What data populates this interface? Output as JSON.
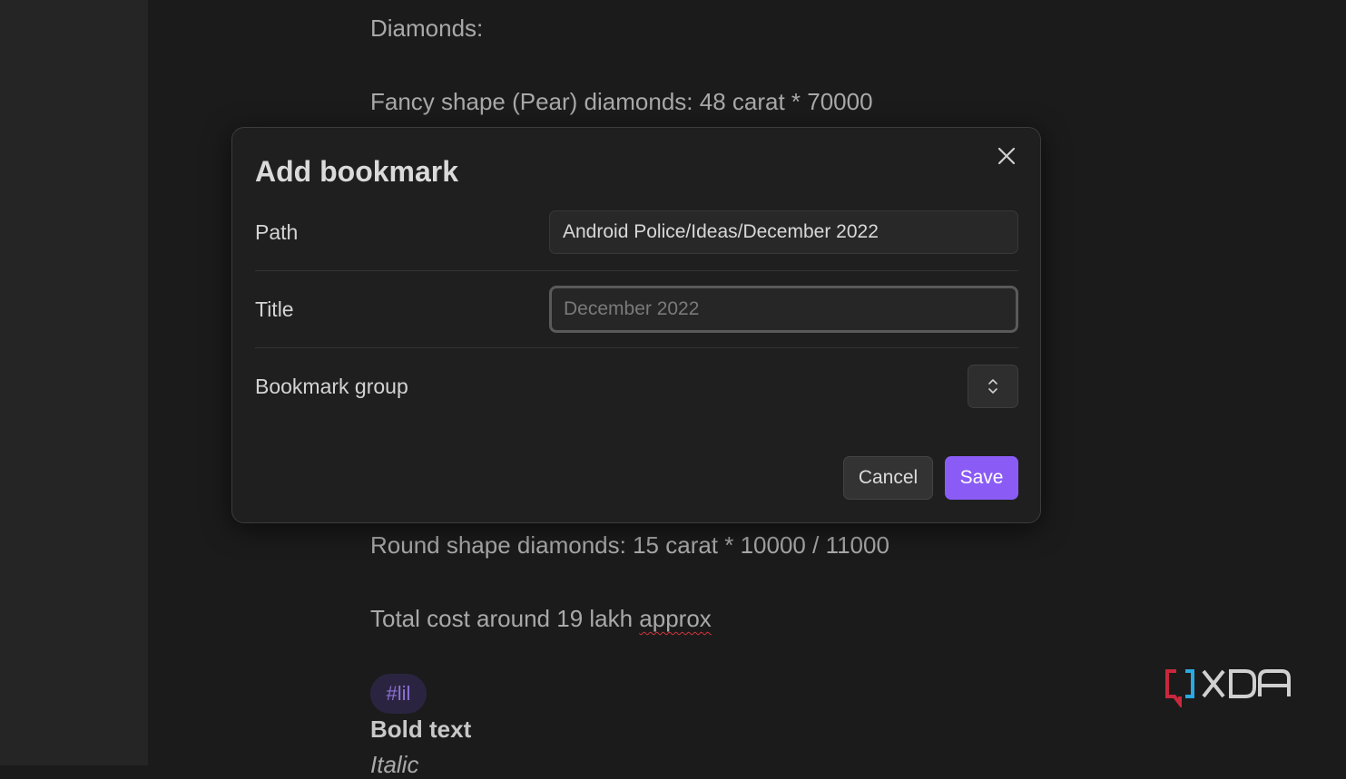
{
  "editor": {
    "line1": "Diamonds:",
    "line2": "Fancy shape (Pear) diamonds: 48 carat * 70000",
    "line3": "Round shape diamonds: 15 carat * 10000 / 11000",
    "line4_prefix": "Total cost around 19 lakh ",
    "line4_misspelled": "approx",
    "tag": "#lil",
    "bold_line": "Bold text",
    "italic_line": "Italic"
  },
  "modal": {
    "title": "Add bookmark",
    "path_label": "Path",
    "path_value": "Android Police/Ideas/December 2022",
    "title_label": "Title",
    "title_placeholder": "December 2022",
    "group_label": "Bookmark group",
    "cancel_label": "Cancel",
    "save_label": "Save"
  },
  "icons": {
    "close": "close-icon",
    "select": "chevron-up-down-icon",
    "logo": "xda-logo"
  },
  "colors": {
    "accent": "#8a5cf5",
    "tag_text": "#8d71d6",
    "spellcheck": "#d0343a",
    "logo_red": "#c8283c",
    "logo_blue": "#2aa8e0"
  },
  "watermark": "XDA"
}
